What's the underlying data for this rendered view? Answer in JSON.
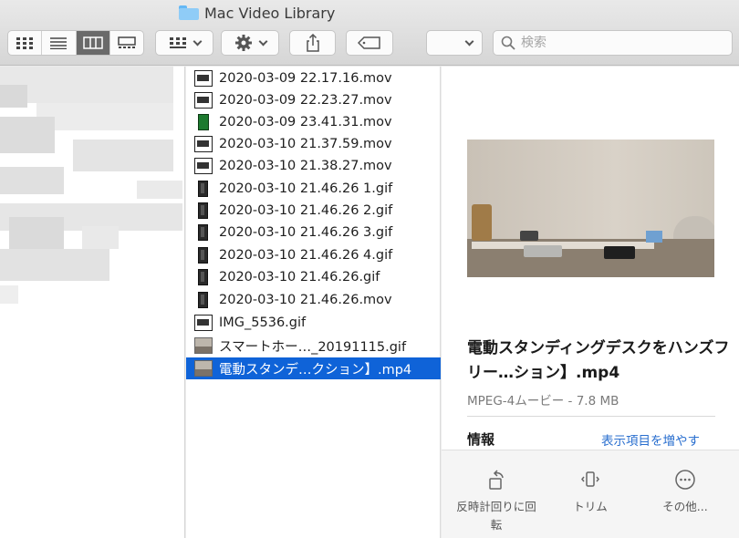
{
  "window": {
    "title": "Mac Video Library"
  },
  "toolbar": {
    "view_modes": [
      "icon-view",
      "list-view",
      "column-view",
      "gallery-view"
    ],
    "active_view": "column-view",
    "search_placeholder": "検索"
  },
  "files": [
    {
      "name": "2020-03-09 22.17.16.mov",
      "thumb": "landscape"
    },
    {
      "name": "2020-03-09 22.23.27.mov",
      "thumb": "landscape"
    },
    {
      "name": "2020-03-09 23.41.31.mov",
      "thumb": "green"
    },
    {
      "name": "2020-03-10 21.37.59.mov",
      "thumb": "landscape"
    },
    {
      "name": "2020-03-10 21.38.27.mov",
      "thumb": "landscape"
    },
    {
      "name": "2020-03-10 21.46.26 1.gif",
      "thumb": "portrait"
    },
    {
      "name": "2020-03-10 21.46.26 2.gif",
      "thumb": "portrait"
    },
    {
      "name": "2020-03-10 21.46.26 3.gif",
      "thumb": "portrait"
    },
    {
      "name": "2020-03-10 21.46.26 4.gif",
      "thumb": "portrait"
    },
    {
      "name": "2020-03-10 21.46.26.gif",
      "thumb": "portrait"
    },
    {
      "name": "2020-03-10 21.46.26.mov",
      "thumb": "portrait"
    },
    {
      "name": "IMG_5536.gif",
      "thumb": "landscape"
    },
    {
      "name": "スマートホー…_20191115.gif",
      "thumb": "photo"
    },
    {
      "name": "電動スタンデ…クション】.mp4",
      "thumb": "photo",
      "selected": true
    }
  ],
  "preview": {
    "title": "電動スタンディングデスクをハンズフリー…ション】.mp4",
    "kind": "MPEG-4ムービー - 7.8 MB",
    "info_label": "情報",
    "show_more": "表示項目を増やす",
    "actions": [
      {
        "label": "反時計回りに回転",
        "icon": "rotate-left-icon"
      },
      {
        "label": "トリム",
        "icon": "trim-icon"
      },
      {
        "label": "その他...",
        "icon": "more-icon"
      }
    ]
  },
  "colors": {
    "selection": "#0f63d8",
    "link": "#2a6fcf"
  }
}
